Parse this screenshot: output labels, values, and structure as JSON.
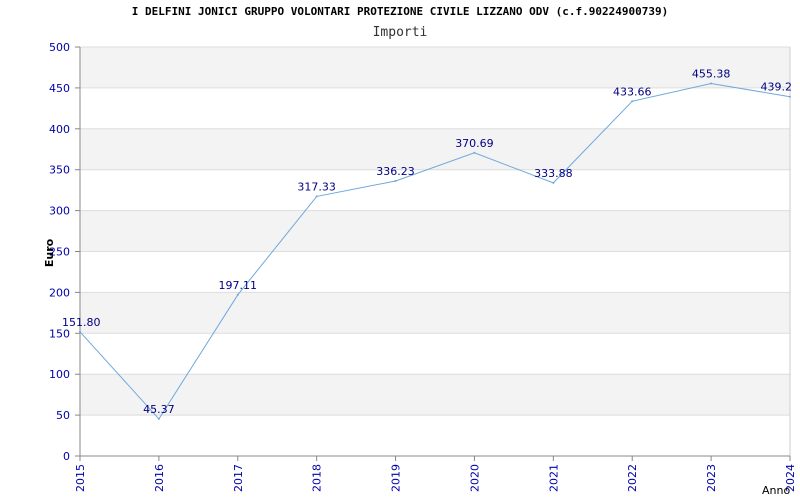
{
  "title": "I DELFINI JONICI GRUPPO VOLONTARI PROTEZIONE CIVILE LIZZANO ODV (c.f.90224900739)",
  "subtitle": "Importi",
  "chart_data": {
    "type": "line",
    "title": "I DELFINI JONICI GRUPPO VOLONTARI PROTEZIONE CIVILE LIZZANO ODV (c.f.90224900739)",
    "subtitle": "Importi",
    "xlabel": "Anno",
    "ylabel": "Euro",
    "categories": [
      "2015",
      "2016",
      "2017",
      "2018",
      "2019",
      "2020",
      "2021",
      "2022",
      "2023",
      "2024"
    ],
    "values": [
      151.8,
      45.37,
      197.11,
      317.33,
      336.23,
      370.69,
      333.88,
      433.66,
      455.38,
      439.2
    ],
    "data_labels": [
      "151.80",
      "45.37",
      "197.11",
      "317.33",
      "336.23",
      "370.69",
      "333.88",
      "433.66",
      "455.38",
      "439.2"
    ],
    "ylim": [
      0,
      500
    ],
    "yticks": [
      0,
      50,
      100,
      150,
      200,
      250,
      300,
      350,
      400,
      450,
      500
    ],
    "grid": true,
    "colors": {
      "line": "#6fa8dc",
      "data_label": "#000080",
      "tick_label": "#0000aa",
      "band_alt": "#f3f3f3",
      "band": "#ffffff",
      "gridline": "#dddddd"
    }
  }
}
